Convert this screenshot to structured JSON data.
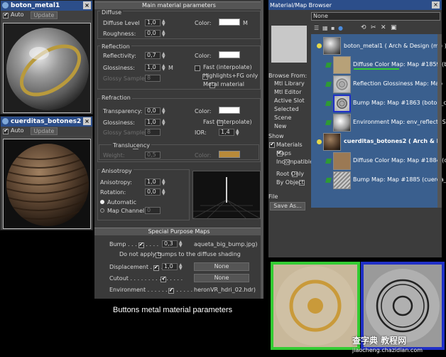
{
  "editor1": {
    "title": "boton_metal1",
    "auto": "Auto",
    "update": "Update"
  },
  "editor2": {
    "title": "cuerditas_botones2",
    "auto": "Auto",
    "update": "Update"
  },
  "params": {
    "title": "Main material parameters",
    "diffuse": {
      "head": "Diffuse",
      "level_label": "Diffuse Level",
      "level": "1,0",
      "color_label": "Color:",
      "m": "M",
      "rough_label": "Roughness:",
      "rough": "0,0"
    },
    "reflection": {
      "head": "Reflection",
      "refl_label": "Reflectivity:",
      "refl": "0,7",
      "color_label": "Color:",
      "gloss_label": "Glossiness:",
      "gloss": "1,0",
      "m": "M",
      "samples_label": "Glossy Samples:",
      "samples": "8",
      "fast": "Fast (interpolate)",
      "highlights": "Highlights+FG only",
      "metal": "Metal material"
    },
    "refraction": {
      "head": "Refraction",
      "trans_label": "Transparency:",
      "trans": "0,0",
      "color_label": "Color:",
      "gloss_label": "Glossiness:",
      "gloss": "1,0",
      "fast": "Fast (interpolate)",
      "samples_label": "Glossy Samples:",
      "samples": "8",
      "ior_label": "IOR:",
      "ior": "1,4",
      "translucency": "Translucency",
      "weight_label": "Weight:",
      "weight": "0,5",
      "tcolor_label": "Color:"
    },
    "aniso": {
      "head": "Anisotropy",
      "aniso_label": "Anisotropy:",
      "aniso": "1,0",
      "rot_label": "Rotation:",
      "rot": "0,0",
      "automatic": "Automatic",
      "channel": "Map Channel:",
      "channel_val": "0"
    },
    "special": {
      "title": "Special Purpose Maps",
      "bump_label": "Bump . . . . . . . . .",
      "bump": "0,3",
      "bump_map": "aqueta_big_bump.jpg)",
      "no_bump": "Do not apply bumps to the diffuse shading",
      "disp_label": "Displacement . . . .",
      "disp": "1,0",
      "disp_map": "None",
      "cutout_label": "Cutout . . . . . . . . . . . . . . .",
      "cutout_map": "None",
      "env_label": "Environment . . . . . . . . . . . . .",
      "env_map": "heronVR_hdri_02.hdr)"
    }
  },
  "caption": "Buttons metal material parameters",
  "browser": {
    "title": "Material/Map Browser",
    "search": "None",
    "browse_from": "Browse From:",
    "mtl_library": "Mtl Library",
    "mtl_editor": "Mtl Editor",
    "active_slot": "Active Slot",
    "selected": "Selected",
    "scene": "Scene",
    "new": "New",
    "show": "Show",
    "materials": "Materials",
    "maps": "Maps",
    "incompatible": "Incompatible",
    "root_only": "Root Only",
    "by_object": "By Object",
    "file": "File",
    "save_as": "Save As...",
    "nodes": [
      "boton_metal1  ( Arch & Design (mi) )",
      "Diffuse Color Map: Map #1859 (b",
      "Reflection Glossiness Map: Map",
      "Bump Map: Map #1863 (boton_c",
      "Environment Map: env_reflect (S",
      "cuerditas_botones2  ( Arch & D",
      "Diffuse Color Map: Map #1884 (c",
      "Bump Map: Map #1885 (cuerda_"
    ]
  },
  "watermark": "查字典 教程网",
  "watermark_url": "jiaocheng.chazidian.com",
  "colors": {
    "green": "#33cc33",
    "blue": "#2030c8",
    "title": "#2c4e8a",
    "tree": "#3a5f8e"
  }
}
